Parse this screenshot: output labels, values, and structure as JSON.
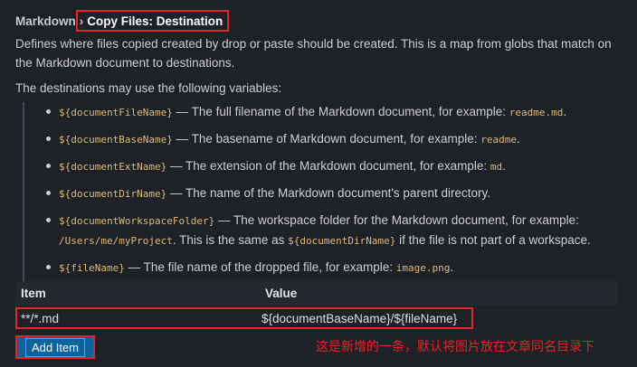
{
  "setting": {
    "category": "Markdown",
    "separator": "›",
    "title": "Copy Files: Destination",
    "description": "Defines where files copied created by drop or paste should be created. This is a map from globs that match on the Markdown document to destinations.",
    "variables_intro": "The destinations may use the following variables:",
    "variables": [
      {
        "code": "${documentFileName}",
        "text": " — The full filename of the Markdown document, for example: ",
        "example": "readme.md",
        "tail": "."
      },
      {
        "code": "${documentBaseName}",
        "text": " — The basename of Markdown document, for example: ",
        "example": "readme",
        "tail": "."
      },
      {
        "code": "${documentExtName}",
        "text": " — The extension of the Markdown document, for example: ",
        "example": "md",
        "tail": "."
      },
      {
        "code": "${documentDirName}",
        "text": " — The name of the Markdown document's parent directory.",
        "example": "",
        "tail": ""
      },
      {
        "code": "${documentWorkspaceFolder}",
        "text": " — The workspace folder for the Markdown document, for example: ",
        "example": "/Users/me/myProject",
        "tail": ". This is the same as ",
        "code2": "${documentDirName}",
        "tail2": " if the file is not part of a workspace."
      },
      {
        "code": "${fileName}",
        "text": " — The file name of the dropped file, for example: ",
        "example": "image.png",
        "tail": "."
      }
    ]
  },
  "table": {
    "col_item": "Item",
    "col_value": "Value",
    "rows": [
      {
        "item": "**/*.md",
        "value": "${documentBaseName}/${fileName}"
      }
    ]
  },
  "add_button_label": "Add Item",
  "annotation": "这是新增的一条，默认将图片放在文章同名目录下",
  "colors": {
    "highlight_border": "#e0242b",
    "button_bg": "#0e639c",
    "code_text": "#d7ba7d",
    "background": "#1e2126"
  }
}
